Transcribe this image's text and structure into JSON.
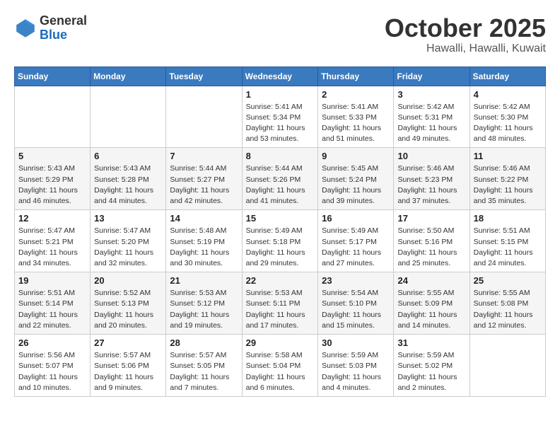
{
  "header": {
    "logo": {
      "general": "General",
      "blue": "Blue"
    },
    "month_title": "October 2025",
    "location": "Hawalli, Hawalli, Kuwait"
  },
  "weekdays": [
    "Sunday",
    "Monday",
    "Tuesday",
    "Wednesday",
    "Thursday",
    "Friday",
    "Saturday"
  ],
  "weeks": [
    [
      {
        "day": "",
        "sunrise": "",
        "sunset": "",
        "daylight": ""
      },
      {
        "day": "",
        "sunrise": "",
        "sunset": "",
        "daylight": ""
      },
      {
        "day": "",
        "sunrise": "",
        "sunset": "",
        "daylight": ""
      },
      {
        "day": "1",
        "sunrise": "Sunrise: 5:41 AM",
        "sunset": "Sunset: 5:34 PM",
        "daylight": "Daylight: 11 hours and 53 minutes."
      },
      {
        "day": "2",
        "sunrise": "Sunrise: 5:41 AM",
        "sunset": "Sunset: 5:33 PM",
        "daylight": "Daylight: 11 hours and 51 minutes."
      },
      {
        "day": "3",
        "sunrise": "Sunrise: 5:42 AM",
        "sunset": "Sunset: 5:31 PM",
        "daylight": "Daylight: 11 hours and 49 minutes."
      },
      {
        "day": "4",
        "sunrise": "Sunrise: 5:42 AM",
        "sunset": "Sunset: 5:30 PM",
        "daylight": "Daylight: 11 hours and 48 minutes."
      }
    ],
    [
      {
        "day": "5",
        "sunrise": "Sunrise: 5:43 AM",
        "sunset": "Sunset: 5:29 PM",
        "daylight": "Daylight: 11 hours and 46 minutes."
      },
      {
        "day": "6",
        "sunrise": "Sunrise: 5:43 AM",
        "sunset": "Sunset: 5:28 PM",
        "daylight": "Daylight: 11 hours and 44 minutes."
      },
      {
        "day": "7",
        "sunrise": "Sunrise: 5:44 AM",
        "sunset": "Sunset: 5:27 PM",
        "daylight": "Daylight: 11 hours and 42 minutes."
      },
      {
        "day": "8",
        "sunrise": "Sunrise: 5:44 AM",
        "sunset": "Sunset: 5:26 PM",
        "daylight": "Daylight: 11 hours and 41 minutes."
      },
      {
        "day": "9",
        "sunrise": "Sunrise: 5:45 AM",
        "sunset": "Sunset: 5:24 PM",
        "daylight": "Daylight: 11 hours and 39 minutes."
      },
      {
        "day": "10",
        "sunrise": "Sunrise: 5:46 AM",
        "sunset": "Sunset: 5:23 PM",
        "daylight": "Daylight: 11 hours and 37 minutes."
      },
      {
        "day": "11",
        "sunrise": "Sunrise: 5:46 AM",
        "sunset": "Sunset: 5:22 PM",
        "daylight": "Daylight: 11 hours and 35 minutes."
      }
    ],
    [
      {
        "day": "12",
        "sunrise": "Sunrise: 5:47 AM",
        "sunset": "Sunset: 5:21 PM",
        "daylight": "Daylight: 11 hours and 34 minutes."
      },
      {
        "day": "13",
        "sunrise": "Sunrise: 5:47 AM",
        "sunset": "Sunset: 5:20 PM",
        "daylight": "Daylight: 11 hours and 32 minutes."
      },
      {
        "day": "14",
        "sunrise": "Sunrise: 5:48 AM",
        "sunset": "Sunset: 5:19 PM",
        "daylight": "Daylight: 11 hours and 30 minutes."
      },
      {
        "day": "15",
        "sunrise": "Sunrise: 5:49 AM",
        "sunset": "Sunset: 5:18 PM",
        "daylight": "Daylight: 11 hours and 29 minutes."
      },
      {
        "day": "16",
        "sunrise": "Sunrise: 5:49 AM",
        "sunset": "Sunset: 5:17 PM",
        "daylight": "Daylight: 11 hours and 27 minutes."
      },
      {
        "day": "17",
        "sunrise": "Sunrise: 5:50 AM",
        "sunset": "Sunset: 5:16 PM",
        "daylight": "Daylight: 11 hours and 25 minutes."
      },
      {
        "day": "18",
        "sunrise": "Sunrise: 5:51 AM",
        "sunset": "Sunset: 5:15 PM",
        "daylight": "Daylight: 11 hours and 24 minutes."
      }
    ],
    [
      {
        "day": "19",
        "sunrise": "Sunrise: 5:51 AM",
        "sunset": "Sunset: 5:14 PM",
        "daylight": "Daylight: 11 hours and 22 minutes."
      },
      {
        "day": "20",
        "sunrise": "Sunrise: 5:52 AM",
        "sunset": "Sunset: 5:13 PM",
        "daylight": "Daylight: 11 hours and 20 minutes."
      },
      {
        "day": "21",
        "sunrise": "Sunrise: 5:53 AM",
        "sunset": "Sunset: 5:12 PM",
        "daylight": "Daylight: 11 hours and 19 minutes."
      },
      {
        "day": "22",
        "sunrise": "Sunrise: 5:53 AM",
        "sunset": "Sunset: 5:11 PM",
        "daylight": "Daylight: 11 hours and 17 minutes."
      },
      {
        "day": "23",
        "sunrise": "Sunrise: 5:54 AM",
        "sunset": "Sunset: 5:10 PM",
        "daylight": "Daylight: 11 hours and 15 minutes."
      },
      {
        "day": "24",
        "sunrise": "Sunrise: 5:55 AM",
        "sunset": "Sunset: 5:09 PM",
        "daylight": "Daylight: 11 hours and 14 minutes."
      },
      {
        "day": "25",
        "sunrise": "Sunrise: 5:55 AM",
        "sunset": "Sunset: 5:08 PM",
        "daylight": "Daylight: 11 hours and 12 minutes."
      }
    ],
    [
      {
        "day": "26",
        "sunrise": "Sunrise: 5:56 AM",
        "sunset": "Sunset: 5:07 PM",
        "daylight": "Daylight: 11 hours and 10 minutes."
      },
      {
        "day": "27",
        "sunrise": "Sunrise: 5:57 AM",
        "sunset": "Sunset: 5:06 PM",
        "daylight": "Daylight: 11 hours and 9 minutes."
      },
      {
        "day": "28",
        "sunrise": "Sunrise: 5:57 AM",
        "sunset": "Sunset: 5:05 PM",
        "daylight": "Daylight: 11 hours and 7 minutes."
      },
      {
        "day": "29",
        "sunrise": "Sunrise: 5:58 AM",
        "sunset": "Sunset: 5:04 PM",
        "daylight": "Daylight: 11 hours and 6 minutes."
      },
      {
        "day": "30",
        "sunrise": "Sunrise: 5:59 AM",
        "sunset": "Sunset: 5:03 PM",
        "daylight": "Daylight: 11 hours and 4 minutes."
      },
      {
        "day": "31",
        "sunrise": "Sunrise: 5:59 AM",
        "sunset": "Sunset: 5:02 PM",
        "daylight": "Daylight: 11 hours and 2 minutes."
      },
      {
        "day": "",
        "sunrise": "",
        "sunset": "",
        "daylight": ""
      }
    ]
  ]
}
